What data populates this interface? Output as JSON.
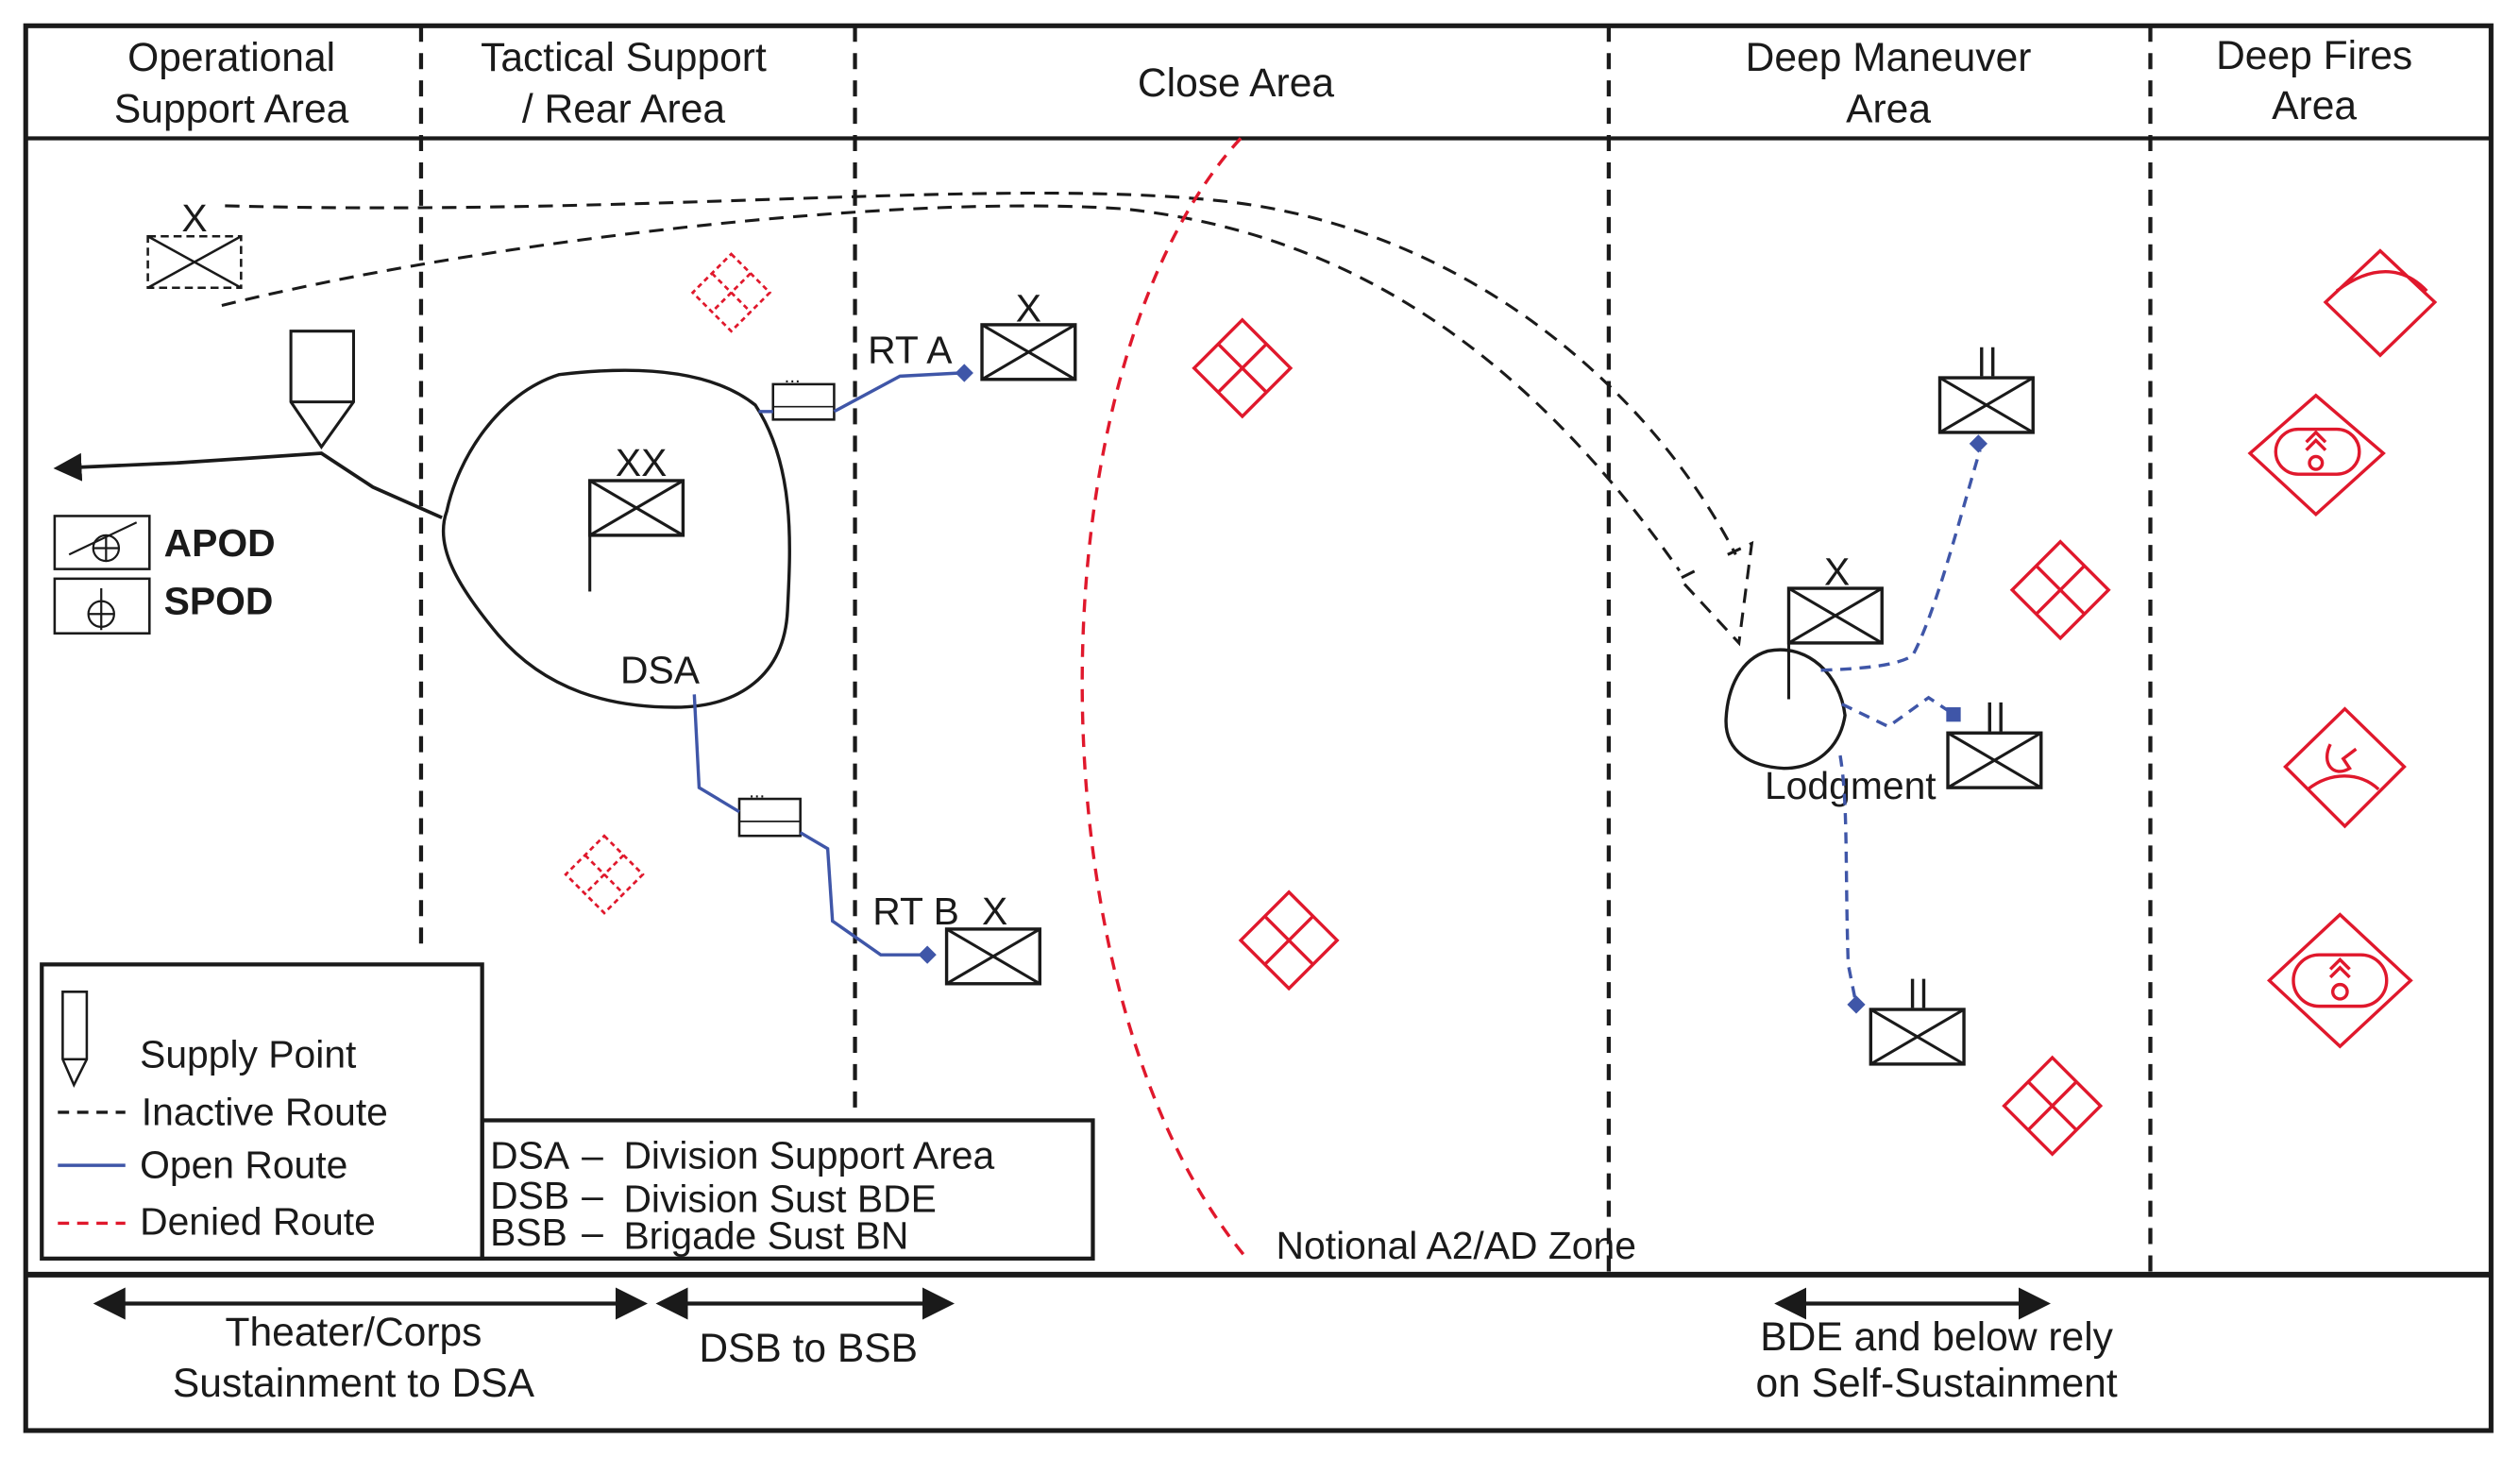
{
  "headers": {
    "operational": [
      "Operational",
      "Support Area"
    ],
    "tactical": [
      "Tactical Support",
      "/ Rear Area"
    ],
    "close": "Close Area",
    "deep_maneuver": [
      "Deep Maneuver",
      "Area"
    ],
    "deep_fires": [
      "Deep Fires",
      "Area"
    ]
  },
  "labels": {
    "apod": "APOD",
    "spod": "SPOD",
    "dsa": "DSA",
    "lodgment": "Lodgment",
    "rt_a": "RT A",
    "rt_b": "RT B",
    "a2ad_zone": "Notional A2/AD Zone"
  },
  "echelons": {
    "brigade": "X",
    "division": "XX",
    "battalion": "II"
  },
  "legend": {
    "supply_point": "Supply Point",
    "inactive_route": "Inactive Route",
    "open_route": "Open Route",
    "denied_route": "Denied Route"
  },
  "abbreviations": [
    {
      "abbr": "DSA",
      "meaning": "Division Support Area"
    },
    {
      "abbr": "DSB",
      "meaning": "Division Sust BDE"
    },
    {
      "abbr": "BSB",
      "meaning": "Brigade Sust BN"
    }
  ],
  "bottom": {
    "theater": [
      "Theater/Corps",
      "Sustainment to DSA"
    ],
    "dsb_bsb": "DSB to BSB",
    "bde": [
      "BDE and below rely",
      "on Self-Sustainment"
    ]
  },
  "colors": {
    "open_route": "#3f56a8",
    "denied": "#e0182c",
    "line": "#1a1a1a"
  }
}
